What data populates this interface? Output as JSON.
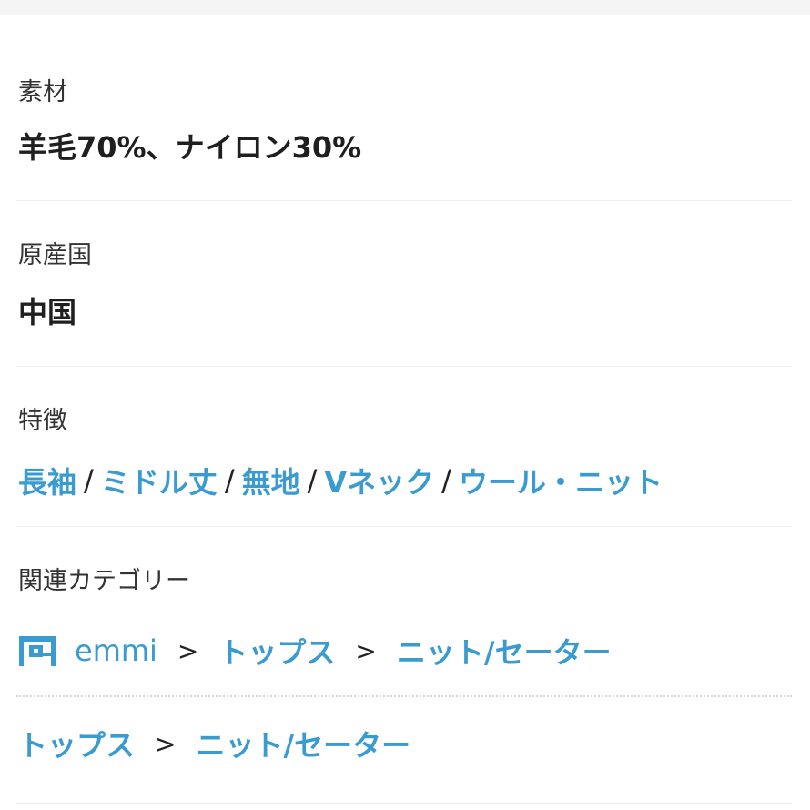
{
  "material": {
    "label": "素材",
    "value": "羊毛70%、ナイロン30%"
  },
  "origin": {
    "label": "原産国",
    "value": "中国"
  },
  "features": {
    "label": "特徴",
    "items": [
      "長袖",
      "ミドル丈",
      "無地",
      "Vネック",
      "ウール・ニット"
    ],
    "separator": "/"
  },
  "related": {
    "label": "関連カテゴリー",
    "shop_path": {
      "icon": "shop-icon",
      "items": [
        "emmi",
        "トップス",
        "ニット/セーター"
      ]
    },
    "general_path": {
      "items": [
        "トップス",
        "ニット/セーター"
      ]
    },
    "chevron": ">"
  },
  "colors": {
    "link": "#3a9bd0",
    "divider": "#eeeeee"
  }
}
